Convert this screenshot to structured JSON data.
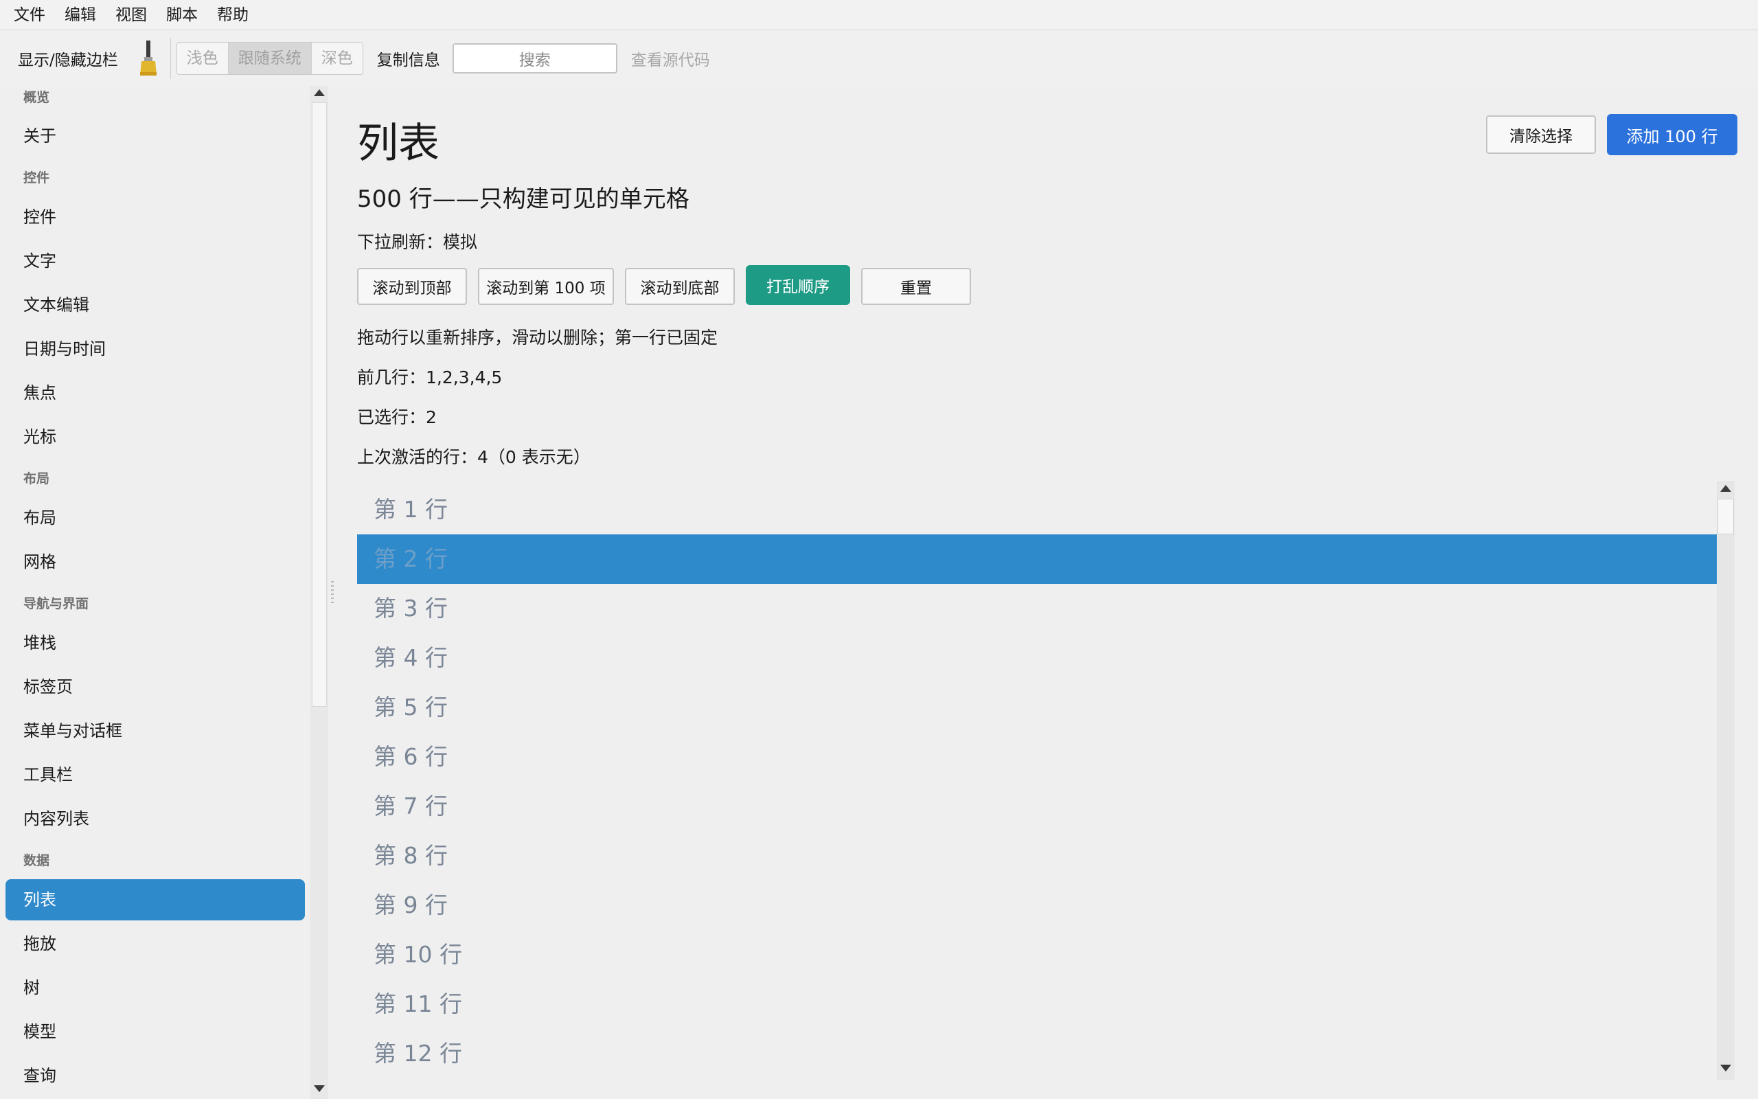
{
  "menubar": {
    "items": [
      {
        "label": "文件"
      },
      {
        "label": "编辑"
      },
      {
        "label": "视图"
      },
      {
        "label": "脚本"
      },
      {
        "label": "帮助"
      }
    ]
  },
  "toolbar": {
    "toggle_sidebar": "显示/隐藏边栏",
    "theme_icon": "brush-icon",
    "theme": {
      "light": "浅色",
      "system": "跟随系统",
      "dark": "深色",
      "selected": "跟随系统"
    },
    "copy_info": "复制信息",
    "search_placeholder": "搜索",
    "view_source": "查看源代码"
  },
  "sidebar": {
    "sections": [
      {
        "title": "概览",
        "items": [
          "关于"
        ]
      },
      {
        "title": "控件",
        "items": [
          "控件",
          "文字",
          "文本编辑",
          "日期与时间",
          "焦点",
          "光标"
        ]
      },
      {
        "title": "布局",
        "items": [
          "布局",
          "网格"
        ]
      },
      {
        "title": "导航与界面",
        "items": [
          "堆栈",
          "标签页",
          "菜单与对话框",
          "工具栏",
          "内容列表"
        ]
      },
      {
        "title": "数据",
        "items": [
          "列表",
          "拖放",
          "树",
          "模型",
          "查询"
        ]
      }
    ],
    "selected": "列表"
  },
  "main": {
    "title": "列表",
    "subtitle": "500 行——只构建可见的单元格",
    "pull_refresh": "下拉刷新：模拟",
    "buttons": {
      "scroll_top": "滚动到顶部",
      "scroll_100": "滚动到第 100 项",
      "scroll_bottom": "滚动到底部",
      "shuffle": "打乱顺序",
      "reset": "重置"
    },
    "clear_selection": "清除选择",
    "add_rows": "添加 100 行",
    "hint": "拖动行以重新排序，滑动以删除；第一行已固定",
    "first_rows": "前几行：1,2,3,4,5",
    "selected_count": "已选行：2",
    "last_activated": "上次激活的行：4（0 表示无）",
    "rows": [
      "第 1 行",
      "第 2 行",
      "第 3 行",
      "第 4 行",
      "第 5 行",
      "第 6 行",
      "第 7 行",
      "第 8 行",
      "第 9 行",
      "第 10 行",
      "第 11 行",
      "第 12 行"
    ],
    "selected_row": "第 2 行"
  },
  "colors": {
    "selection": "#2f8acb",
    "accent_green": "#1e9b85",
    "accent_blue": "#2c72dc"
  }
}
